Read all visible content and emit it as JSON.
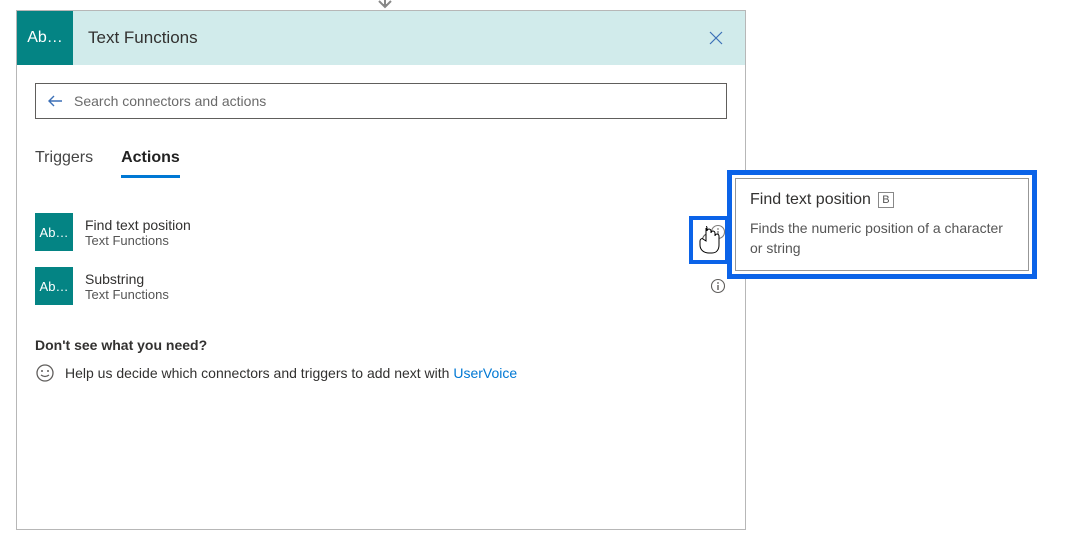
{
  "connector_icon_label": "Ab…",
  "header": {
    "title": "Text Functions"
  },
  "search": {
    "placeholder": "Search connectors and actions"
  },
  "tabs": {
    "triggers": "Triggers",
    "actions": "Actions",
    "active": "Actions"
  },
  "actions": [
    {
      "title": "Find text position",
      "subtitle": "Text Functions"
    },
    {
      "title": "Substring",
      "subtitle": "Text Functions"
    }
  ],
  "help": {
    "heading": "Don't see what you need?",
    "text_before": "Help us decide which connectors and triggers to add next with ",
    "link": "UserVoice"
  },
  "tooltip": {
    "title": "Find text position",
    "badge": "B",
    "description": "Finds the numeric position of a character or string"
  }
}
